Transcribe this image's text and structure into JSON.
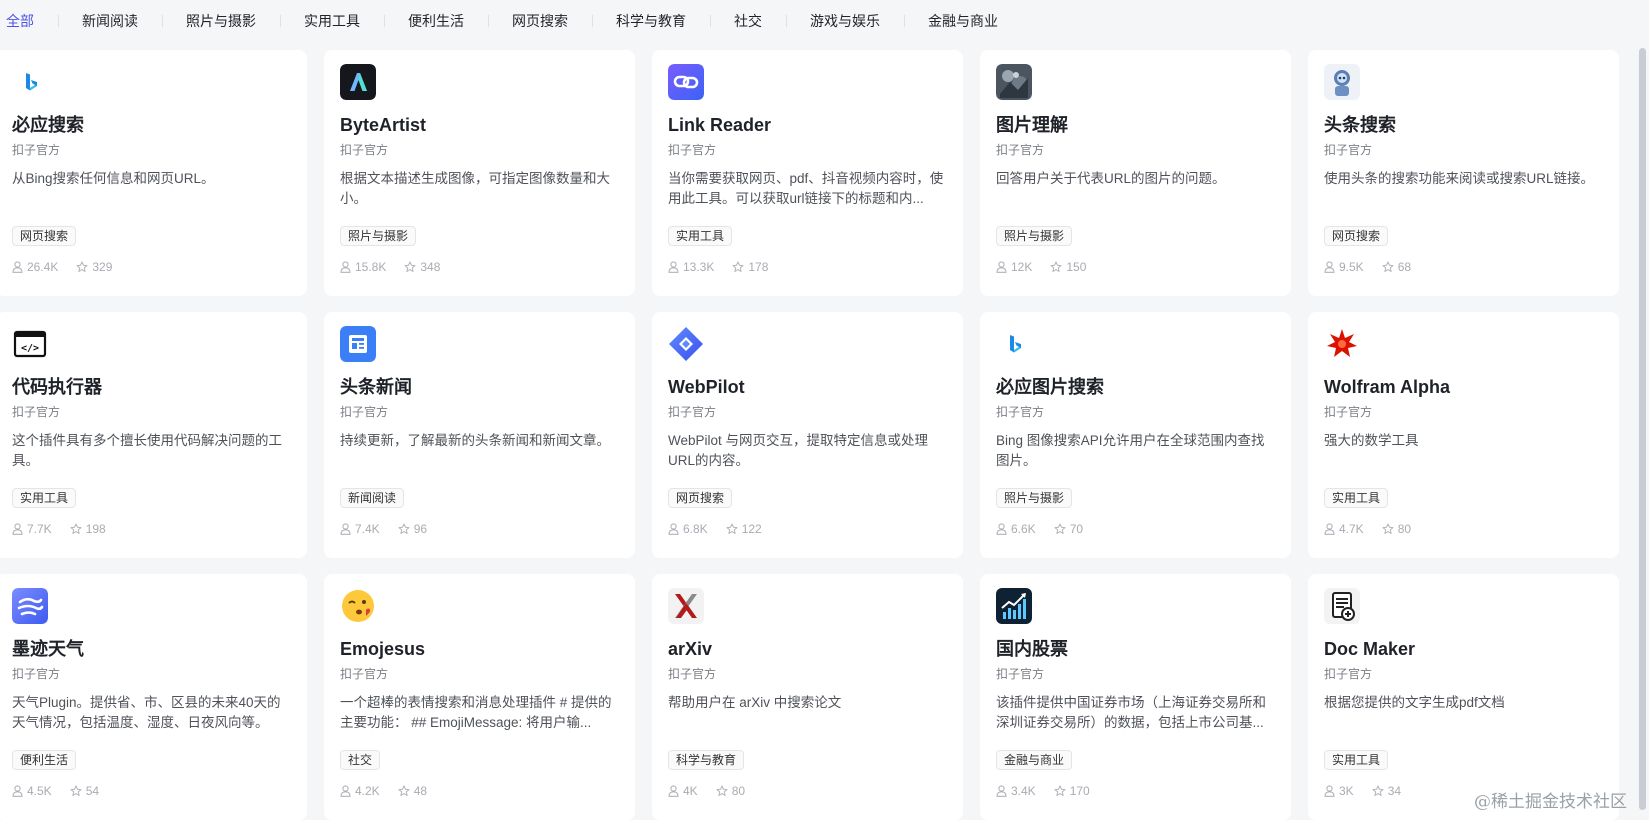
{
  "tabs": [
    "全部",
    "新闻阅读",
    "照片与摄影",
    "实用工具",
    "便利生活",
    "网页搜索",
    "科学与教育",
    "社交",
    "游戏与娱乐",
    "金融与商业"
  ],
  "active_tab": 0,
  "cards": [
    {
      "name": "必应搜索",
      "author": "扣子官方",
      "desc": "从Bing搜索任何信息和网页URL。",
      "tag": "网页搜索",
      "users": "26.4K",
      "stars": "329",
      "icon": "bing-logo-icon"
    },
    {
      "name": "ByteArtist",
      "author": "扣子官方",
      "desc": "根据文本描述生成图像，可指定图像数量和大小。",
      "tag": "照片与摄影",
      "users": "15.8K",
      "stars": "348",
      "icon": "byteartist-logo-icon"
    },
    {
      "name": "Link Reader",
      "author": "扣子官方",
      "desc": "当你需要获取网页、pdf、抖音视频内容时，使用此工具。可以获取url链接下的标题和内...",
      "tag": "实用工具",
      "users": "13.3K",
      "stars": "178",
      "icon": "link-icon"
    },
    {
      "name": "图片理解",
      "author": "扣子官方",
      "desc": "回答用户关于代表URL的图片的问题。",
      "tag": "照片与摄影",
      "users": "12K",
      "stars": "150",
      "icon": "image-understanding-icon"
    },
    {
      "name": "头条搜索",
      "author": "扣子官方",
      "desc": "使用头条的搜索功能来阅读或搜索URL链接。",
      "tag": "网页搜索",
      "users": "9.5K",
      "stars": "68",
      "icon": "robot-icon"
    },
    {
      "name": "代码执行器",
      "author": "扣子官方",
      "desc": "这个插件具有多个擅长使用代码解决问题的工具。",
      "tag": "实用工具",
      "users": "7.7K",
      "stars": "198",
      "icon": "code-icon"
    },
    {
      "name": "头条新闻",
      "author": "扣子官方",
      "desc": "持续更新，了解最新的头条新闻和新闻文章。",
      "tag": "新闻阅读",
      "users": "7.4K",
      "stars": "96",
      "icon": "news-icon"
    },
    {
      "name": "WebPilot",
      "author": "扣子官方",
      "desc": "WebPilot 与网页交互，提取特定信息或处理URL的内容。",
      "tag": "网页搜索",
      "users": "6.8K",
      "stars": "122",
      "icon": "webpilot-logo-icon"
    },
    {
      "name": "必应图片搜索",
      "author": "扣子官方",
      "desc": "Bing 图像搜索API允许用户在全球范围内查找图片。",
      "tag": "照片与摄影",
      "users": "6.6K",
      "stars": "70",
      "icon": "bing-logo-icon"
    },
    {
      "name": "Wolfram Alpha",
      "author": "扣子官方",
      "desc": "强大的数学工具",
      "tag": "实用工具",
      "users": "4.7K",
      "stars": "80",
      "icon": "wolfram-logo-icon"
    },
    {
      "name": "墨迹天气",
      "author": "扣子官方",
      "desc": "天气Plugin。提供省、市、区县的未来40天的天气情况，包括温度、湿度、日夜风向等。",
      "tag": "便利生活",
      "users": "4.5K",
      "stars": "54",
      "icon": "weather-icon"
    },
    {
      "name": "Emojesus",
      "author": "扣子官方",
      "desc": "一个超棒的表情搜索和消息处理插件 # 提供的主要功能： ## EmojiMessage: 将用户输...",
      "tag": "社交",
      "users": "4.2K",
      "stars": "48",
      "icon": "emoji-icon"
    },
    {
      "name": "arXiv",
      "author": "扣子官方",
      "desc": "帮助用户在 arXiv 中搜索论文",
      "tag": "科学与教育",
      "users": "4K",
      "stars": "80",
      "icon": "arxiv-logo-icon"
    },
    {
      "name": "国内股票",
      "author": "扣子官方",
      "desc": "该插件提供中国证券市场（上海证券交易所和深圳证券交易所）的数据，包括上市公司基...",
      "tag": "金融与商业",
      "users": "3.4K",
      "stars": "170",
      "icon": "stock-chart-icon"
    },
    {
      "name": "Doc Maker",
      "author": "扣子官方",
      "desc": "根据您提供的文字生成pdf文档",
      "tag": "实用工具",
      "users": "3K",
      "stars": "34",
      "icon": "doc-maker-icon"
    }
  ],
  "watermark": "@稀土掘金技术社区"
}
